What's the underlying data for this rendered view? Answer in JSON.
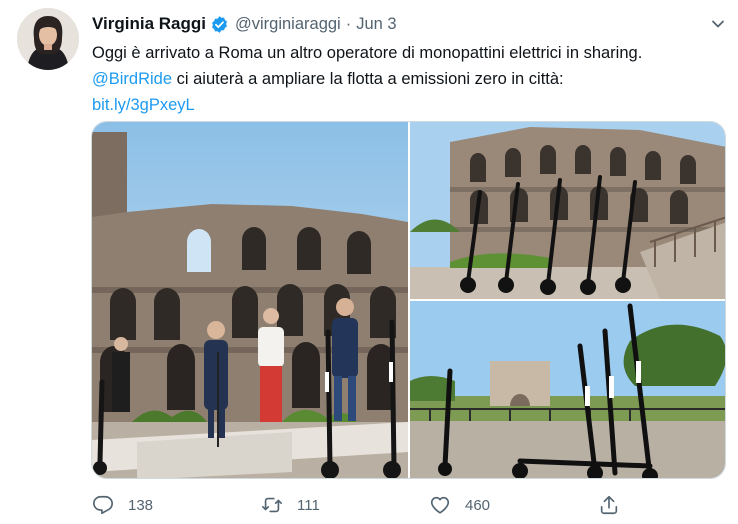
{
  "author": {
    "display_name": "Virginia Raggi",
    "handle": "@virginiaraggi",
    "separator": "·",
    "date": "Jun 3",
    "verified": true
  },
  "tweet": {
    "line1": "Oggi è arrivato a Roma un altro operatore di monopattini elettrici in sharing.",
    "mention": "@BirdRide",
    "line2_rest": " ci aiuterà a ampliare la flotta a emissioni zero in città:",
    "link": "bit.ly/3gPxeyL"
  },
  "media": {
    "photos": [
      {
        "subject": "Colosseum with five people and electric scooters"
      },
      {
        "subject": "Row of electric scooters in front of the Colosseum"
      },
      {
        "subject": "Electric scooters near the Arch of Constantine"
      }
    ]
  },
  "actions": {
    "reply_count": "138",
    "retweet_count": "111",
    "like_count": "460"
  },
  "colors": {
    "accent": "#1d9bf0",
    "text": "#0f1419",
    "secondary": "#536471",
    "border": "#cfd9de"
  },
  "icons": [
    "verified-badge-icon",
    "chevron-down-icon",
    "reply-icon",
    "retweet-icon",
    "like-icon",
    "share-icon"
  ]
}
